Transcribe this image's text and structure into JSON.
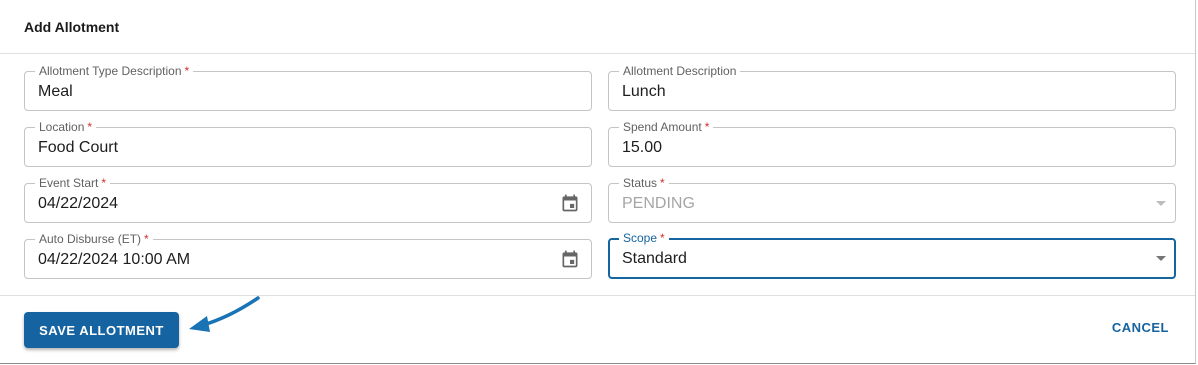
{
  "dialog": {
    "title": "Add Allotment"
  },
  "fields": {
    "allotment_type_description": {
      "label": "Allotment Type Description",
      "required": "*",
      "value": "Meal"
    },
    "allotment_description": {
      "label": "Allotment Description",
      "value": "Lunch"
    },
    "location": {
      "label": "Location",
      "required": "*",
      "value": "Food Court"
    },
    "spend_amount": {
      "label": "Spend Amount",
      "required": "*",
      "value": "15.00"
    },
    "event_start": {
      "label": "Event Start",
      "required": "*",
      "value": "04/22/2024",
      "icon": "calendar-icon"
    },
    "status": {
      "label": "Status",
      "required": "*",
      "value": "PENDING",
      "disabled": true
    },
    "auto_disburse": {
      "label": "Auto Disburse (ET)",
      "required": "*",
      "value": "04/22/2024 10:00 AM",
      "icon": "calendar-icon"
    },
    "scope": {
      "label": "Scope",
      "required": "*",
      "value": "Standard",
      "focused": true
    }
  },
  "actions": {
    "save_label": "SAVE ALLOTMENT",
    "cancel_label": "CANCEL"
  },
  "colors": {
    "primary": "#1563a0",
    "required": "#d32f2f",
    "annotation_arrow": "#1a73b5"
  }
}
